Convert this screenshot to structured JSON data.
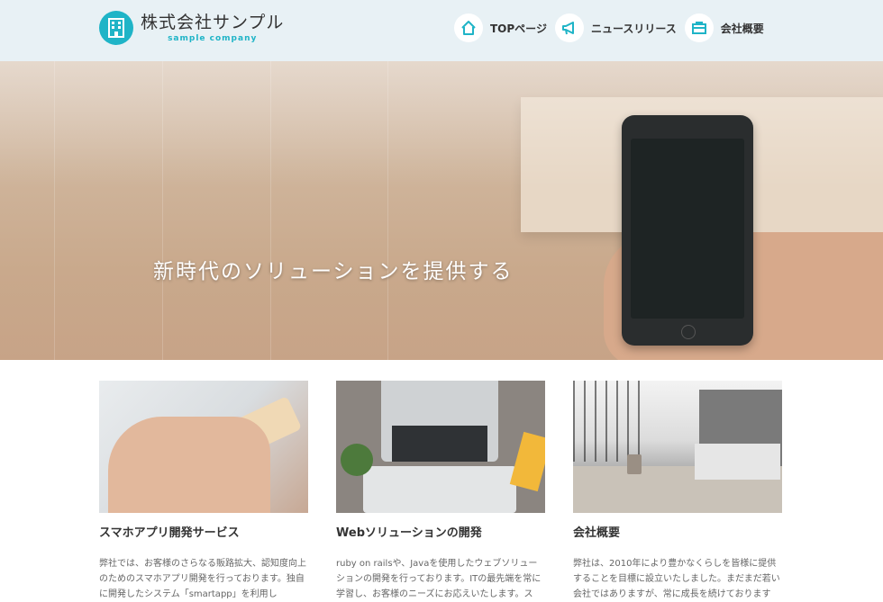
{
  "header": {
    "logo_name": "株式会社サンプル",
    "logo_sub": "sample company",
    "nav": [
      {
        "label": "TOPページ",
        "icon": "home-icon"
      },
      {
        "label": "ニュースリリース",
        "icon": "megaphone-icon"
      },
      {
        "label": "会社概要",
        "icon": "briefcase-icon"
      }
    ]
  },
  "hero": {
    "title": "新時代のソリューションを提供する"
  },
  "cards": [
    {
      "title": "スマホアプリ開発サービス",
      "text": "弊社では、お客様のさらなる販路拡大、認知度向上のためのスマホアプリ開発を行っております。独自に開発したシステム「smartapp」を利用し"
    },
    {
      "title": "Webソリューションの開発",
      "text": "ruby on railsや、Javaを使用したウェブソリューションの開発を行っております。ITの最先端を常に学習し、お客様のニーズにお応えいたします。ス"
    },
    {
      "title": "会社概要",
      "text": "弊社は、2010年により豊かなくらしを皆様に提供することを目標に設立いたしました。まだまだ若い会社ではありますが、常に成長を続けております"
    }
  ],
  "colors": {
    "accent": "#1fb4c7",
    "header_bg": "#e8f1f5"
  }
}
